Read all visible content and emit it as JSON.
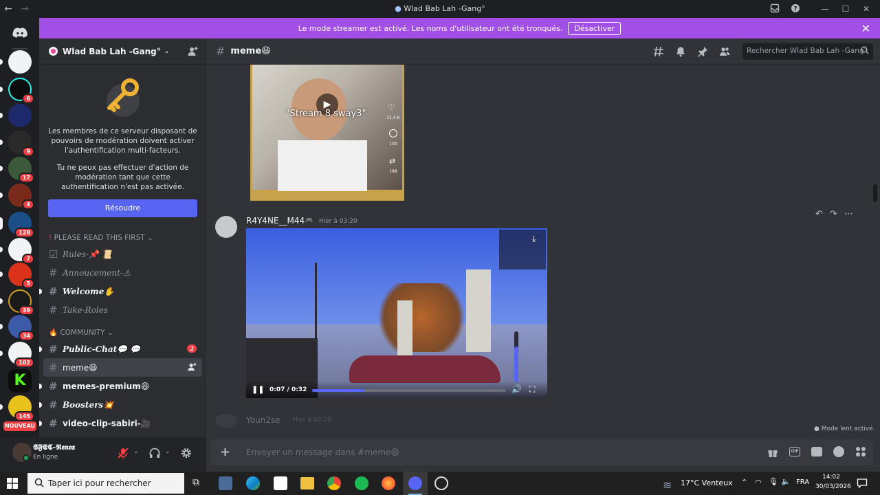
{
  "window": {
    "title": "Wlad Bab Lah -Gang°"
  },
  "banner": {
    "text": "Le mode streamer est activé. Les noms d'utilisateur ont été tronqués.",
    "button": "Désactiver"
  },
  "rail": {
    "servers": [
      {
        "badge": ""
      },
      {
        "badge": "6"
      },
      {
        "badge": ""
      },
      {
        "badge": "9"
      },
      {
        "badge": "17"
      },
      {
        "badge": "4"
      },
      {
        "badge": "128"
      },
      {
        "badge": "7"
      },
      {
        "badge": "5"
      },
      {
        "badge": "39"
      },
      {
        "badge": "34"
      },
      {
        "badge": "102"
      },
      {
        "badge": ""
      },
      {
        "badge": "145"
      }
    ],
    "new_label": "NOUVEAU"
  },
  "sidebar": {
    "server_name": "Wlad Bab Lah -Gang°",
    "mfa_text_1": "Les membres de ce serveur disposant de pouvoirs de modération doivent activer l'authentification multi-facteurs.",
    "mfa_text_2": "Tu ne peux pas effectuer d'action de modération tant que cette authentification n'est pas activée.",
    "resolve_button": "Résoudre",
    "category_1": "PLEASE READ THIS FIRST",
    "category_2": "COMMUNITY",
    "channels": [
      {
        "name": "Rules-📌 📜"
      },
      {
        "name": "Annoucement-⚠"
      },
      {
        "name": "Welcome✋"
      },
      {
        "name": "Take-Roles"
      },
      {
        "name": "Public-Chat💬 💬",
        "badge": "2"
      },
      {
        "name": "meme😆"
      },
      {
        "name": "memes-premium😆"
      },
      {
        "name": "Boosters💥"
      },
      {
        "name": "video-clip-sabiri-🎥"
      }
    ]
  },
  "user": {
    "name": "𝕾𝕱𝕰𝕮-𝕽𝖊𝖓𝖔𝖝",
    "status": "En ligne"
  },
  "header": {
    "channel": "meme😆",
    "search_placeholder": "Rechercher Wlad Bab Lah -Gang°"
  },
  "messages": {
    "video1_caption": "\"Stream 8 sway3\"",
    "video1_likes": "11,4 K",
    "video1_comments": "100",
    "video1_shares": "188",
    "msg_author": "R4Y4NE__M44",
    "msg_time": "Hier à 03:20",
    "video_time": "0:07 / 0:32",
    "next_author": "Youn2se",
    "next_time": "Hier à 03:20",
    "slow_mode": "Mode lent activé."
  },
  "input": {
    "placeholder": "Envoyer un message dans #meme😆"
  },
  "taskbar": {
    "search_placeholder": "Taper ici pour rechercher",
    "weather": "17°C Venteux",
    "lang": "FRA",
    "time": "14:02",
    "date": "30/03/2026"
  },
  "colors": {
    "accent": "#5865f2",
    "banner": "#a14fe6",
    "badge": "#f23f43",
    "online": "#23a55a"
  }
}
